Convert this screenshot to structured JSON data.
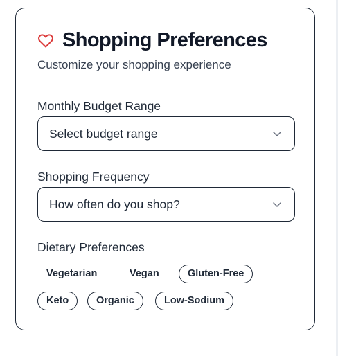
{
  "header": {
    "title": "Shopping Preferences",
    "subtitle": "Customize your shopping experience",
    "icon": "heart-icon",
    "accent_color": "#dc3c3c"
  },
  "budget": {
    "label": "Monthly Budget Range",
    "placeholder": "Select budget range",
    "icon": "chevron-down-icon"
  },
  "frequency": {
    "label": "Shopping Frequency",
    "placeholder": "How often do you shop?",
    "icon": "chevron-down-icon"
  },
  "dietary": {
    "label": "Dietary Preferences",
    "options": [
      {
        "label": "Vegetarian",
        "selected": false
      },
      {
        "label": "Vegan",
        "selected": false
      },
      {
        "label": "Gluten-Free",
        "selected": true
      },
      {
        "label": "Keto",
        "selected": true
      },
      {
        "label": "Organic",
        "selected": true
      },
      {
        "label": "Low-Sodium",
        "selected": true
      }
    ]
  }
}
